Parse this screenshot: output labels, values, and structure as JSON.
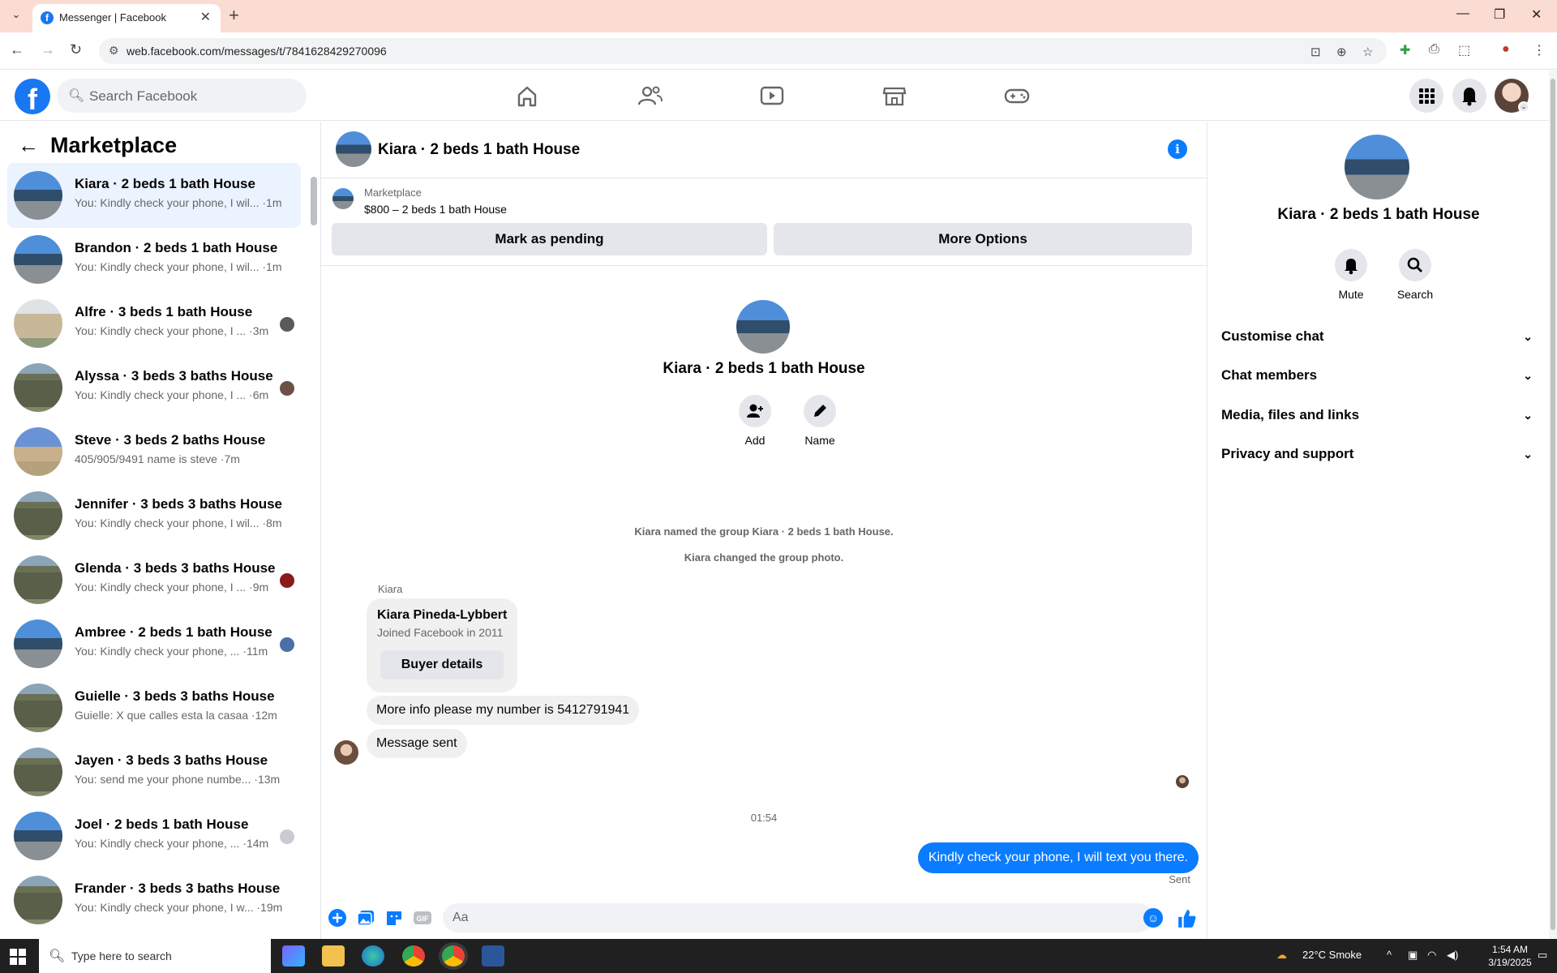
{
  "browser": {
    "tab_title": "Messenger | Facebook",
    "url": "web.facebook.com/messages/t/7841628429270096"
  },
  "header": {
    "search_placeholder": "Search Facebook"
  },
  "sidebar": {
    "title": "Marketplace",
    "conversations": [
      {
        "name": "Kiara · 2 beds 1 bath House",
        "preview": "You: Kindly check your phone, I wil... ·1m",
        "active": true
      },
      {
        "name": "Brandon · 2 beds 1 bath House",
        "preview": "You: Kindly check your phone, I wil... ·1m"
      },
      {
        "name": "Alfre · 3 beds 1 bath House",
        "preview": "You: Kindly check your phone, I ... ·3m"
      },
      {
        "name": "Alyssa · 3 beds 3 baths House",
        "preview": "You: Kindly check your phone, I ... ·6m"
      },
      {
        "name": "Steve · 3 beds 2 baths House",
        "preview": "405/905/9491 name is steve ·7m"
      },
      {
        "name": "Jennifer · 3 beds 3 baths House",
        "preview": "You: Kindly check your phone, I wil... ·8m"
      },
      {
        "name": "Glenda · 3 beds 3 baths House",
        "preview": "You: Kindly check your phone, I ... ·9m"
      },
      {
        "name": "Ambree · 2 beds 1 bath House",
        "preview": "You: Kindly check your phone, ... ·11m"
      },
      {
        "name": "Guielle · 3 beds 3 baths House",
        "preview": "Guielle: X que calles esta la casaa ·12m"
      },
      {
        "name": "Jayen · 3 beds 3 baths House",
        "preview": "You: send me your phone numbe... ·13m"
      },
      {
        "name": "Joel · 2 beds 1 bath House",
        "preview": "You: Kindly check your phone, ... ·14m"
      },
      {
        "name": "Frander · 3 beds 3 baths House",
        "preview": "You: Kindly check your phone, I w... ·19m"
      }
    ]
  },
  "chat": {
    "title": "Kiara · 2 beds 1 bath House",
    "listing_category": "Marketplace",
    "listing_price": "$800 – 2 beds 1 bath House",
    "mark_pending": "Mark as pending",
    "more_options": "More Options",
    "profile_name": "Kiara · 2 beds 1 bath House",
    "add_label": "Add",
    "name_label": "Name",
    "system_messages": [
      "Kiara named the group Kiara · 2 beds 1 bath House.",
      "Kiara changed the group photo."
    ],
    "sender": "Kiara",
    "buyer_name": "Kiara Pineda-Lybbert",
    "buyer_joined": "Joined Facebook in 2011",
    "buyer_details": "Buyer details",
    "messages_in": [
      "More info please my number is 5412791941",
      "Message sent"
    ],
    "timestamp": "01:54",
    "message_out": "Kindly check your phone, I will text you there.",
    "status": "Sent",
    "composer_placeholder": "Aa"
  },
  "rightpanel": {
    "name": "Kiara · 2 beds 1 bath House",
    "mute": "Mute",
    "search": "Search",
    "sections": [
      "Customise chat",
      "Chat members",
      "Media, files and links",
      "Privacy and support"
    ]
  },
  "taskbar": {
    "search_placeholder": "Type here to search",
    "weather": "22°C  Smoke",
    "time": "1:54 AM",
    "date": "3/19/2025"
  },
  "colors": {
    "accent": "#0a7cff",
    "brand": "#1877f2",
    "active_row": "#ebf3ff"
  }
}
